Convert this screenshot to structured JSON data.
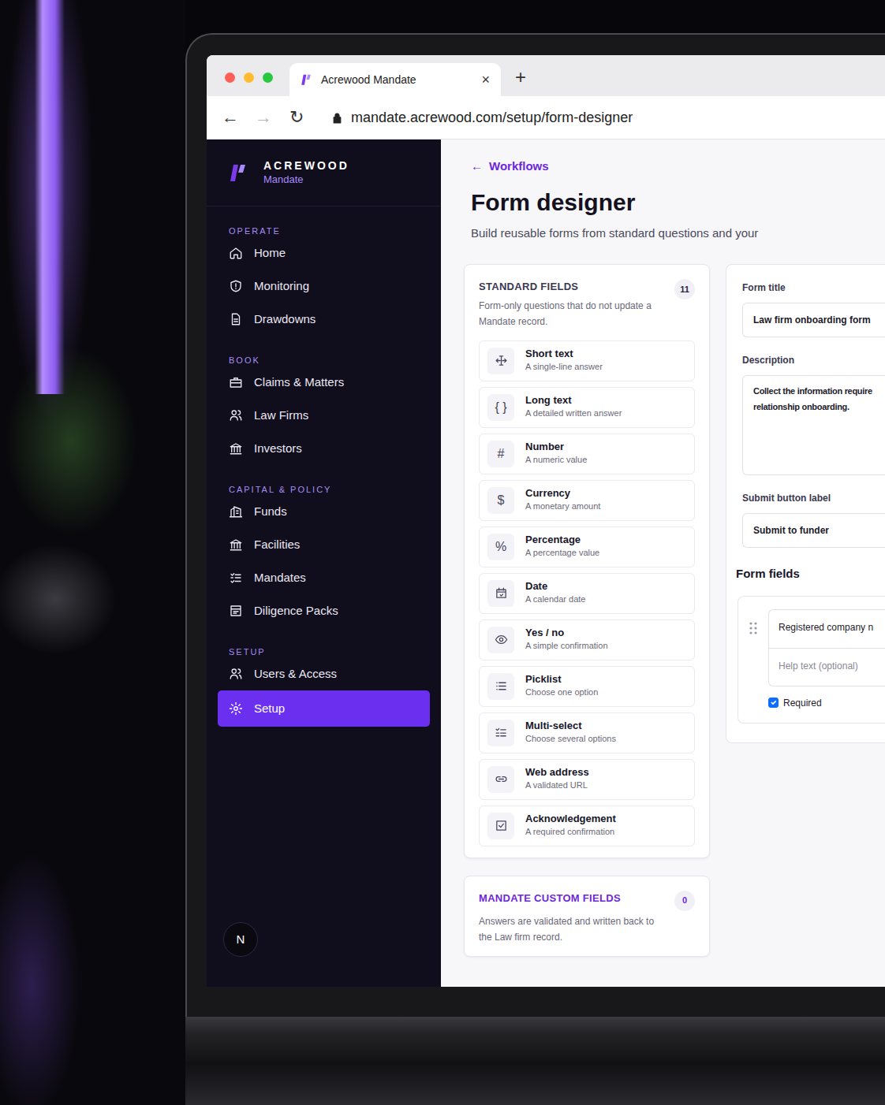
{
  "browser": {
    "tab_title": "Acrewood Mandate",
    "tab_close": "×",
    "new_tab": "+",
    "back": "←",
    "forward": "→",
    "forward_disabled": true,
    "reload": "↻",
    "url": "mandate.acrewood.com/setup/form-designer"
  },
  "sidebar": {
    "brand": "ACREWOOD",
    "product": "Mandate",
    "sections": [
      {
        "label": "OPERATE",
        "items": [
          {
            "label": "Home",
            "selected": false
          },
          {
            "label": "Monitoring",
            "selected": false
          },
          {
            "label": "Drawdowns",
            "selected": false
          }
        ]
      },
      {
        "label": "BOOK",
        "items": [
          {
            "label": "Claims & Matters",
            "selected": false
          },
          {
            "label": "Law Firms",
            "selected": false
          },
          {
            "label": "Investors",
            "selected": false
          }
        ]
      },
      {
        "label": "CAPITAL & POLICY",
        "items": [
          {
            "label": "Funds",
            "selected": false
          },
          {
            "label": "Facilities",
            "selected": false
          },
          {
            "label": "Mandates",
            "selected": false
          },
          {
            "label": "Diligence Packs",
            "selected": false
          }
        ]
      },
      {
        "label": "SETUP",
        "items": [
          {
            "label": "Users & Access",
            "selected": false
          },
          {
            "label": "Setup",
            "selected": true
          }
        ]
      }
    ],
    "avatar": "N"
  },
  "page": {
    "back_arrow": "←",
    "back_link": "Workflows",
    "title": "Form designer",
    "subtitle": "Build reusable forms from standard questions and your"
  },
  "standard_fields": {
    "title": "STANDARD FIELDS",
    "count": "11",
    "description": "Form-only questions that do not update a Mandate record.",
    "items": [
      {
        "name": "Short text",
        "hint": "A single-line answer"
      },
      {
        "name": "Long text",
        "hint": "A detailed written answer",
        "glyph": "{ }"
      },
      {
        "name": "Number",
        "hint": "A numeric value",
        "glyph": "#"
      },
      {
        "name": "Currency",
        "hint": "A monetary amount",
        "glyph": "$"
      },
      {
        "name": "Percentage",
        "hint": "A percentage value",
        "glyph": "%"
      },
      {
        "name": "Date",
        "hint": "A calendar date"
      },
      {
        "name": "Yes / no",
        "hint": "A simple confirmation"
      },
      {
        "name": "Picklist",
        "hint": "Choose one option"
      },
      {
        "name": "Multi-select",
        "hint": "Choose several options"
      },
      {
        "name": "Web address",
        "hint": "A validated URL"
      },
      {
        "name": "Acknowledgement",
        "hint": "A required confirmation"
      }
    ]
  },
  "custom_fields": {
    "title": "MANDATE CUSTOM FIELDS",
    "count": "0",
    "description": "Answers are validated and written back to the Law firm record."
  },
  "form": {
    "title_label": "Form title",
    "title_value": "Law firm onboarding form",
    "description_label": "Description",
    "description_lines": [
      "Collect the information require",
      "relationship onboarding."
    ],
    "submit_label_label": "Submit button label",
    "submit_label_value": "Submit to funder",
    "fields_heading": "Form fields",
    "fields": [
      {
        "label_value": "Registered company n",
        "help_placeholder": "Help text (optional)",
        "required_label": "Required",
        "required": true
      }
    ]
  }
}
